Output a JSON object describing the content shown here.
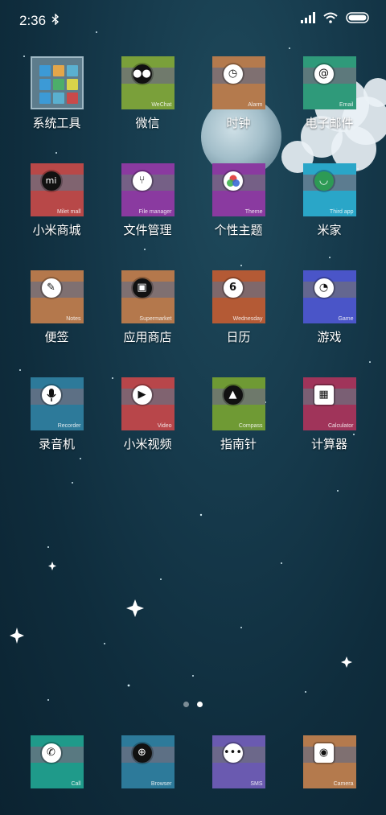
{
  "status": {
    "time": "2:36"
  },
  "apps_row1": [
    {
      "label": "系统工具",
      "sub": "",
      "color": "#2a7fb4",
      "icon": "tools-folder-icon"
    },
    {
      "label": "微信",
      "sub": "WeChat",
      "color": "#7aa03a",
      "icon": "wechat-icon"
    },
    {
      "label": "时钟",
      "sub": "Alarm",
      "color": "#b47a4d",
      "icon": "clock-icon"
    },
    {
      "label": "电子邮件",
      "sub": "Email",
      "color": "#2f9a7a",
      "icon": "at-icon"
    }
  ],
  "apps_row2": [
    {
      "label": "小米商城",
      "sub": "Milet mall",
      "color": "#b84848",
      "icon": "mi-store-icon"
    },
    {
      "label": "文件管理",
      "sub": "File manager",
      "color": "#8a3aa0",
      "icon": "usb-icon"
    },
    {
      "label": "个性主题",
      "sub": "Theme",
      "color": "#8a3aa0",
      "icon": "theme-icon"
    },
    {
      "label": "米家",
      "sub": "Third app",
      "color": "#2aa6c8",
      "icon": "mijia-icon"
    }
  ],
  "apps_row3": [
    {
      "label": "便签",
      "sub": "Notes",
      "color": "#b4784c",
      "icon": "pen-icon"
    },
    {
      "label": "应用商店",
      "sub": "Supermarket",
      "color": "#b4784c",
      "icon": "box-icon"
    },
    {
      "label": "日历",
      "sub": "Wednesday",
      "day": "6",
      "color": "#b45a35",
      "icon": "calendar-icon"
    },
    {
      "label": "游戏",
      "sub": "Game",
      "color": "#4a55c8",
      "icon": "whistle-icon"
    }
  ],
  "apps_row4": [
    {
      "label": "录音机",
      "sub": "Recorder",
      "color": "#2d7a9a",
      "icon": "microphone-icon"
    },
    {
      "label": "小米视频",
      "sub": "Video",
      "color": "#b8464a",
      "icon": "play-icon"
    },
    {
      "label": "指南针",
      "sub": "Compass",
      "color": "#6f9a34",
      "icon": "compass-icon"
    },
    {
      "label": "计算器",
      "sub": "Calculator",
      "color": "#a0345a",
      "icon": "calculator-icon"
    }
  ],
  "dock": [
    {
      "sub": "Call",
      "color": "#1f9a8a",
      "icon": "phone-icon"
    },
    {
      "sub": "Browser",
      "color": "#2d7a9a",
      "icon": "globe-icon"
    },
    {
      "sub": "SMS",
      "color": "#6a5ab0",
      "icon": "chat-icon"
    },
    {
      "sub": "Camera",
      "color": "#b47a4d",
      "icon": "camera-icon"
    }
  ],
  "page_indicator": {
    "pages": 2,
    "current": 2
  }
}
